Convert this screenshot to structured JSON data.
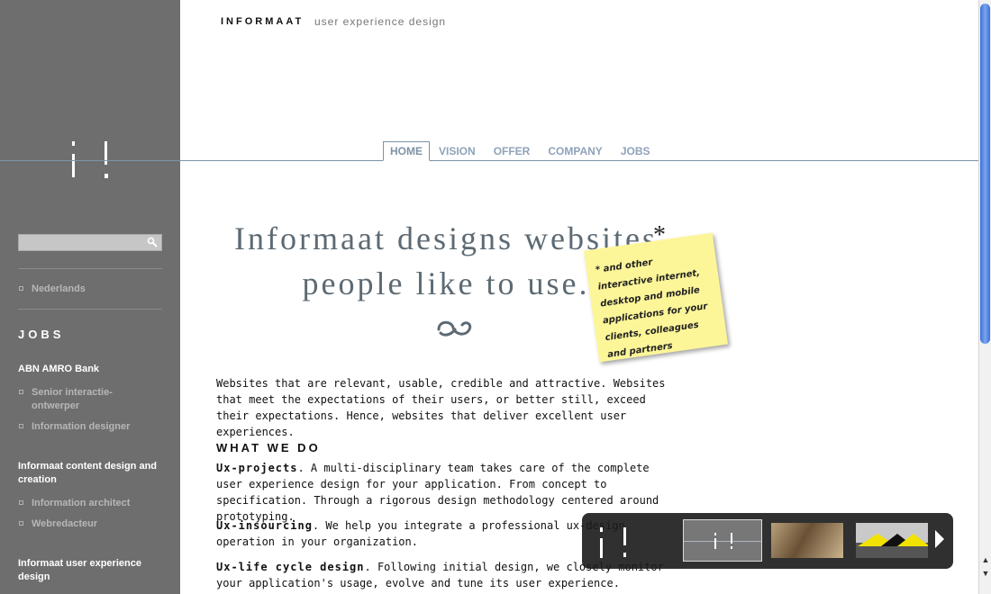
{
  "header": {
    "brand": "INFORMAAT",
    "tagline": "user experience design"
  },
  "nav": {
    "tabs": [
      {
        "label": "HOME",
        "active": true
      },
      {
        "label": "VISION"
      },
      {
        "label": "OFFER"
      },
      {
        "label": "COMPANY"
      },
      {
        "label": "JOBS"
      }
    ]
  },
  "sidebar": {
    "search": {
      "value": "",
      "icon": "search-icon"
    },
    "language_link": "Nederlands",
    "jobs_heading": "JOBS",
    "groups": [
      {
        "title": "ABN AMRO Bank",
        "links": [
          "Senior interactie-ontwerper",
          "Information designer"
        ]
      },
      {
        "title": "Informaat content design and creation",
        "links": [
          "Information architect",
          "Webredacteur"
        ]
      },
      {
        "title": "Informaat user experience design",
        "links": []
      }
    ]
  },
  "hero": {
    "line1": "Informaat designs websites",
    "line2": "people like to use.",
    "asterisk": "*",
    "postit": "* and other interactive internet, desktop and mobile applications for your clients, colleagues and partners"
  },
  "main": {
    "intro": "Websites that are relevant, usable, credible and attractive. Websites that meet the expectations of their users, or better still, exceed their expectations. Hence, websites that deliver excellent user experiences.",
    "section_heading": "WHAT WE DO",
    "items": [
      {
        "title": "Ux-projects",
        "text": ". A multi-disciplinary team takes care of the complete user experience design for your application. From concept to specification. Through a rigorous design methodology centered around prototyping."
      },
      {
        "title": "Ux-insourcing",
        "text": ". We help you integrate a professional ux-design operation in your organization."
      },
      {
        "title": "Ux-life cycle design",
        "text": ". Following initial design, we closely monitor your application's usage, evolve and tune its user experience. Permanent"
      }
    ]
  },
  "colors": {
    "sidebar_bg": "#6e6e6e",
    "accent": "#7d93a6",
    "postit": "#fdf699"
  }
}
